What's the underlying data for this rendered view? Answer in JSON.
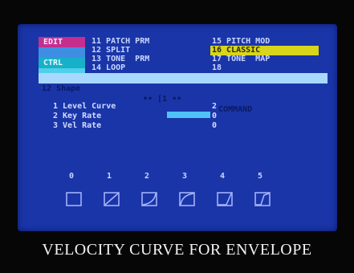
{
  "menu": {
    "tabs": [
      {
        "label": "EDIT",
        "color": "#c52e8f"
      },
      {
        "label": "",
        "color": "#3f8ee3"
      },
      {
        "label": "CTRL",
        "color": "#17b0c9"
      },
      {
        "label": "",
        "color": "#4ed0ea"
      }
    ],
    "col1": [
      "11 PATCH PRM",
      "12 SPLIT",
      "13 TONE  PRM",
      "14 LOOP"
    ],
    "col2": [
      "15 PITCH MOD",
      "16 CLASSIC",
      "17 TONE  MAP",
      "18"
    ]
  },
  "status": {
    "left": "12 Shape",
    "mid": "•• [1 ••",
    "right": "COMMAND"
  },
  "params": [
    {
      "label": "1 Level Curve",
      "value": "2"
    },
    {
      "label": "2 Key Rate",
      "value": "0"
    },
    {
      "label": "3 Vel Rate",
      "value": "0"
    }
  ],
  "curves": {
    "numbers": [
      "0",
      "1",
      "2",
      "3",
      "4",
      "5"
    ],
    "icons": [
      "curve-0-icon",
      "curve-1-icon",
      "curve-2-icon",
      "curve-3-icon",
      "curve-4-icon",
      "curve-5-icon"
    ]
  },
  "caption": "VELOCITY CURVE FOR ENVELOPE",
  "colors": {
    "screen": "#1a35a8",
    "highlight": "#d9d51a",
    "status_bar": "#a9d8ff",
    "cursor": "#4fc3f7"
  }
}
